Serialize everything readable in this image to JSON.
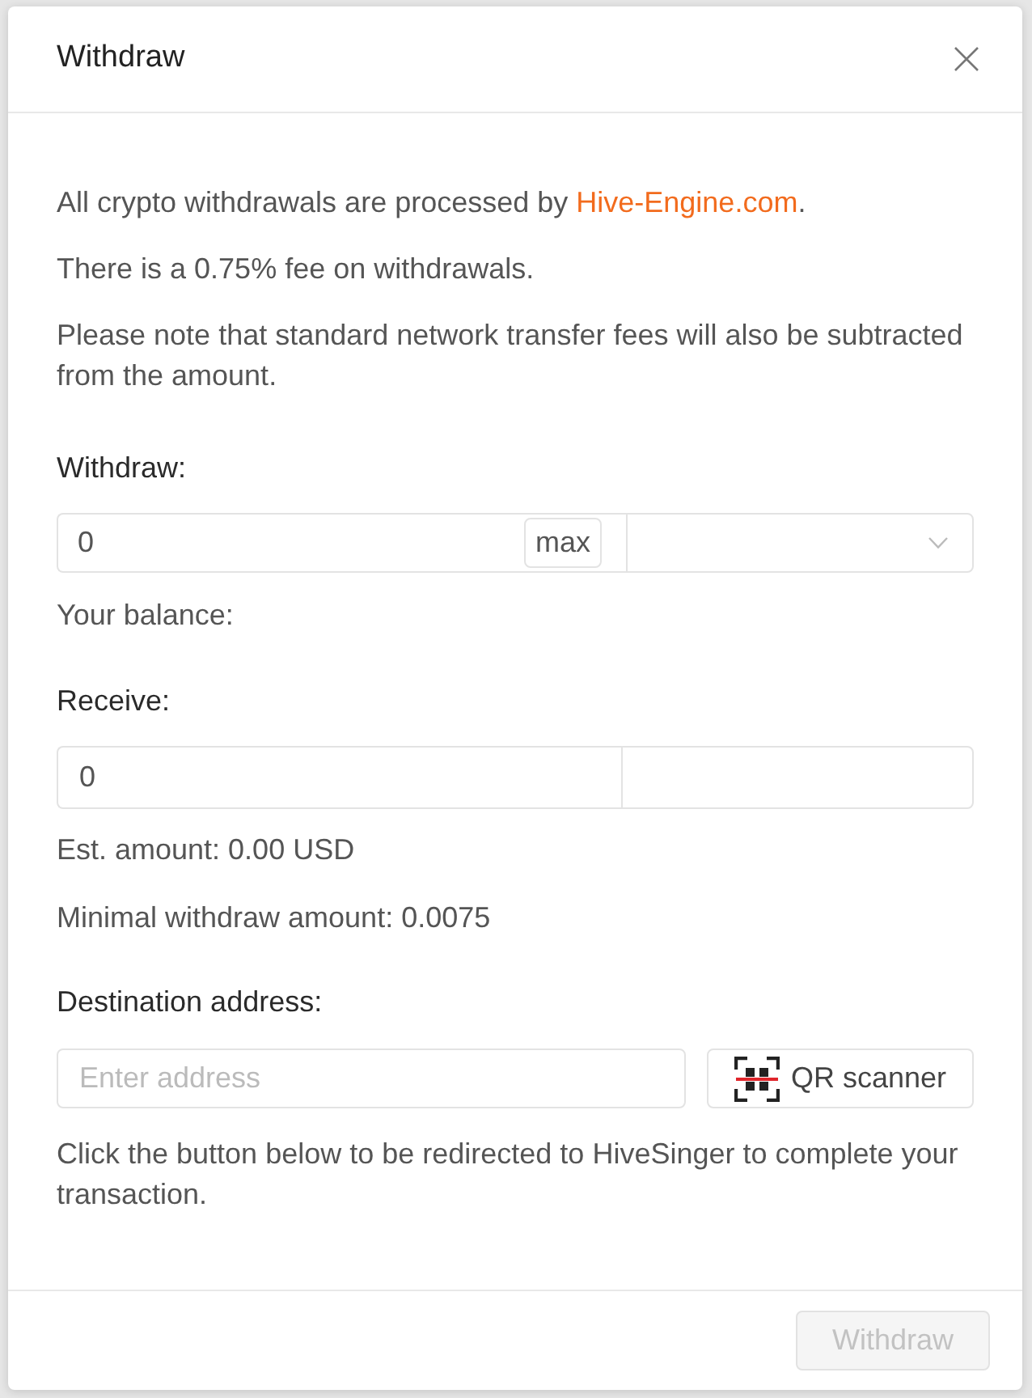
{
  "dialog": {
    "title": "Withdraw"
  },
  "info": [
    {
      "kind": "link_sentence",
      "before": "All crypto withdrawals are processed by ",
      "link": "Hive-Engine.com",
      "after": "."
    },
    {
      "kind": "text",
      "text": "There is a 0.75% fee on withdrawals."
    },
    {
      "kind": "text",
      "text": "Please note that standard network transfer fees will also be subtracted from the amount."
    }
  ],
  "withdraw": {
    "label": "Withdraw:",
    "value": "0",
    "max_button": "max",
    "balance": "Your balance:"
  },
  "receive": {
    "label": "Receive:",
    "value": "0",
    "est_amount": "Est. amount: 0.00 USD",
    "minimal_amount": "Minimal withdraw amount: 0.0075"
  },
  "destination": {
    "label": "Destination address:",
    "placeholder": "Enter address",
    "qr_button": "QR scanner",
    "note": "Click the button below to be redirected to HiveSinger to complete your transaction."
  },
  "footer": {
    "submit": {
      "label": "Withdraw",
      "disabled": true
    }
  }
}
